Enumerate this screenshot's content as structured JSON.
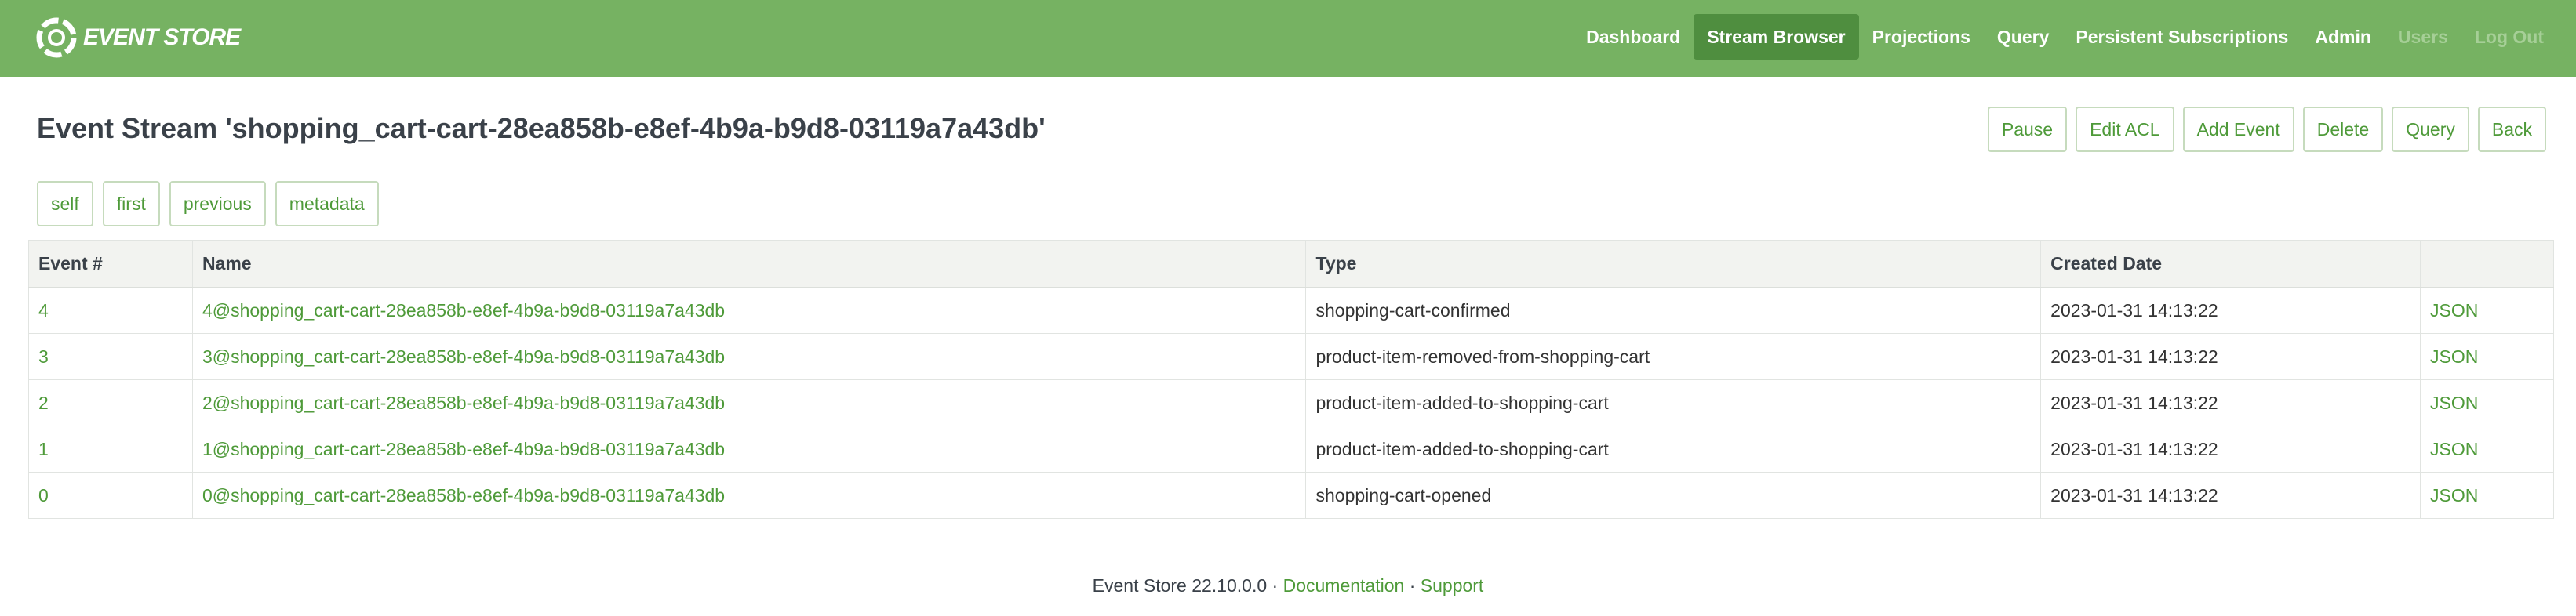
{
  "brand": {
    "name": "EVENT STORE",
    "logo_icon": "event-store-logo-icon"
  },
  "nav": {
    "items": [
      {
        "label": "Dashboard",
        "state": "normal"
      },
      {
        "label": "Stream Browser",
        "state": "active"
      },
      {
        "label": "Projections",
        "state": "normal"
      },
      {
        "label": "Query",
        "state": "normal"
      },
      {
        "label": "Persistent Subscriptions",
        "state": "normal"
      },
      {
        "label": "Admin",
        "state": "normal"
      },
      {
        "label": "Users",
        "state": "muted"
      },
      {
        "label": "Log Out",
        "state": "muted"
      }
    ]
  },
  "page": {
    "title": "Event Stream 'shopping_cart-cart-28ea858b-e8ef-4b9a-b9d8-03119a7a43db'"
  },
  "actions": [
    "Pause",
    "Edit ACL",
    "Add Event",
    "Delete",
    "Query",
    "Back"
  ],
  "links": [
    "self",
    "first",
    "previous",
    "metadata"
  ],
  "table": {
    "columns": [
      "Event #",
      "Name",
      "Type",
      "Created Date",
      ""
    ],
    "rows": [
      {
        "number": "4",
        "name": "4@shopping_cart-cart-28ea858b-e8ef-4b9a-b9d8-03119a7a43db",
        "type": "shopping-cart-confirmed",
        "created": "2023-01-31 14:13:22",
        "action": "JSON"
      },
      {
        "number": "3",
        "name": "3@shopping_cart-cart-28ea858b-e8ef-4b9a-b9d8-03119a7a43db",
        "type": "product-item-removed-from-shopping-cart",
        "created": "2023-01-31 14:13:22",
        "action": "JSON"
      },
      {
        "number": "2",
        "name": "2@shopping_cart-cart-28ea858b-e8ef-4b9a-b9d8-03119a7a43db",
        "type": "product-item-added-to-shopping-cart",
        "created": "2023-01-31 14:13:22",
        "action": "JSON"
      },
      {
        "number": "1",
        "name": "1@shopping_cart-cart-28ea858b-e8ef-4b9a-b9d8-03119a7a43db",
        "type": "product-item-added-to-shopping-cart",
        "created": "2023-01-31 14:13:22",
        "action": "JSON"
      },
      {
        "number": "0",
        "name": "0@shopping_cart-cart-28ea858b-e8ef-4b9a-b9d8-03119a7a43db",
        "type": "shopping-cart-opened",
        "created": "2023-01-31 14:13:22",
        "action": "JSON"
      }
    ]
  },
  "footer": {
    "version": "Event Store 22.10.0.0",
    "separator": " · ",
    "documentation": "Documentation",
    "support": "Support"
  },
  "colors": {
    "navbar": "#76b262",
    "nav_active": "#4f8e3f",
    "nav_muted": "#a6cf97",
    "link": "#4e9a39",
    "button_border": "#c6dbbd",
    "table_header": "#f2f3f0"
  }
}
